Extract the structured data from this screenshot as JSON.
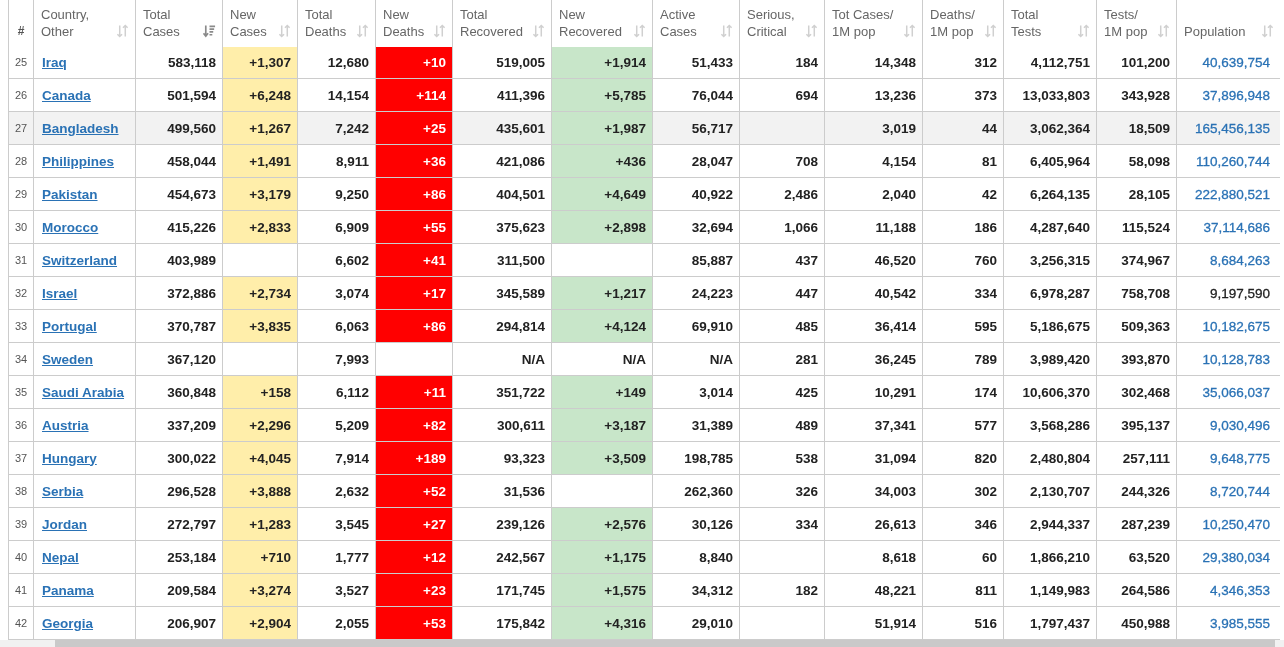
{
  "table": {
    "columns": [
      {
        "label": "#",
        "kind": "rank"
      },
      {
        "label": "Country,\nOther",
        "kind": "country",
        "sorted": false
      },
      {
        "label": "Total\nCases",
        "kind": "number",
        "sorted": true
      },
      {
        "label": "New\nCases",
        "kind": "new_cases",
        "sorted": false
      },
      {
        "label": "Total\nDeaths",
        "kind": "number",
        "sorted": false
      },
      {
        "label": "New\nDeaths",
        "kind": "new_deaths",
        "sorted": false
      },
      {
        "label": "Total\nRecovered",
        "kind": "number",
        "sorted": false
      },
      {
        "label": "New\nRecovered",
        "kind": "new_recovered",
        "sorted": false
      },
      {
        "label": "Active\nCases",
        "kind": "number",
        "sorted": false
      },
      {
        "label": "Serious,\nCritical",
        "kind": "number",
        "sorted": false
      },
      {
        "label": "Tot Cases/\n1M pop",
        "kind": "number",
        "sorted": false
      },
      {
        "label": "Deaths/\n1M pop",
        "kind": "number",
        "sorted": false
      },
      {
        "label": "Total\nTests",
        "kind": "number",
        "sorted": false
      },
      {
        "label": "Tests/\n1M pop",
        "kind": "number",
        "sorted": false
      },
      {
        "label": "Population",
        "kind": "population",
        "sorted": false
      }
    ],
    "rows": [
      {
        "selected": false,
        "cells": [
          "25",
          "Iraq",
          "583,118",
          {
            "value": "+1,307",
            "highlighted": true
          },
          "12,680",
          {
            "value": "+10",
            "highlighted": true
          },
          "519,005",
          {
            "value": "+1,914",
            "highlighted": true
          },
          "51,433",
          "184",
          "14,348",
          "312",
          "4,112,751",
          "101,200",
          {
            "value": "40,639,754",
            "link": true
          }
        ]
      },
      {
        "selected": false,
        "cells": [
          "26",
          "Canada",
          "501,594",
          {
            "value": "+6,248",
            "highlighted": true
          },
          "14,154",
          {
            "value": "+114",
            "highlighted": true
          },
          "411,396",
          {
            "value": "+5,785",
            "highlighted": true
          },
          "76,044",
          "694",
          "13,236",
          "373",
          "13,033,803",
          "343,928",
          {
            "value": "37,896,948",
            "link": true
          }
        ]
      },
      {
        "selected": true,
        "cells": [
          "27",
          "Bangladesh",
          "499,560",
          {
            "value": "+1,267",
            "highlighted": true
          },
          "7,242",
          {
            "value": "+25",
            "highlighted": true
          },
          "435,601",
          {
            "value": "+1,987",
            "highlighted": true
          },
          "56,717",
          null,
          "3,019",
          "44",
          "3,062,364",
          "18,509",
          {
            "value": "165,456,135",
            "link": true
          }
        ]
      },
      {
        "selected": false,
        "cells": [
          "28",
          "Philippines",
          "458,044",
          {
            "value": "+1,491",
            "highlighted": true
          },
          "8,911",
          {
            "value": "+36",
            "highlighted": true
          },
          "421,086",
          {
            "value": "+436",
            "highlighted": true
          },
          "28,047",
          "708",
          "4,154",
          "81",
          "6,405,964",
          "58,098",
          {
            "value": "110,260,744",
            "link": true
          }
        ]
      },
      {
        "selected": false,
        "cells": [
          "29",
          "Pakistan",
          "454,673",
          {
            "value": "+3,179",
            "highlighted": true
          },
          "9,250",
          {
            "value": "+86",
            "highlighted": true
          },
          "404,501",
          {
            "value": "+4,649",
            "highlighted": true
          },
          "40,922",
          "2,486",
          "2,040",
          "42",
          "6,264,135",
          "28,105",
          {
            "value": "222,880,521",
            "link": true
          }
        ]
      },
      {
        "selected": false,
        "cells": [
          "30",
          "Morocco",
          "415,226",
          {
            "value": "+2,833",
            "highlighted": true
          },
          "6,909",
          {
            "value": "+55",
            "highlighted": true
          },
          "375,623",
          {
            "value": "+2,898",
            "highlighted": true
          },
          "32,694",
          "1,066",
          "11,188",
          "186",
          "4,287,640",
          "115,524",
          {
            "value": "37,114,686",
            "link": true
          }
        ]
      },
      {
        "selected": false,
        "cells": [
          "31",
          "Switzerland",
          "403,989",
          {
            "highlighted": false
          },
          "6,602",
          {
            "value": "+41",
            "highlighted": true
          },
          "311,500",
          {
            "highlighted": false
          },
          "85,887",
          "437",
          "46,520",
          "760",
          "3,256,315",
          "374,967",
          {
            "value": "8,684,263",
            "link": true
          }
        ]
      },
      {
        "selected": false,
        "cells": [
          "32",
          "Israel",
          "372,886",
          {
            "value": "+2,734",
            "highlighted": true
          },
          "3,074",
          {
            "value": "+17",
            "highlighted": true
          },
          "345,589",
          {
            "value": "+1,217",
            "highlighted": true
          },
          "24,223",
          "447",
          "40,542",
          "334",
          "6,978,287",
          "758,708",
          {
            "value": "9,197,590",
            "link": false
          }
        ]
      },
      {
        "selected": false,
        "cells": [
          "33",
          "Portugal",
          "370,787",
          {
            "value": "+3,835",
            "highlighted": true
          },
          "6,063",
          {
            "value": "+86",
            "highlighted": true
          },
          "294,814",
          {
            "value": "+4,124",
            "highlighted": true
          },
          "69,910",
          "485",
          "36,414",
          "595",
          "5,186,675",
          "509,363",
          {
            "value": "10,182,675",
            "link": true
          }
        ]
      },
      {
        "selected": false,
        "cells": [
          "34",
          "Sweden",
          "367,120",
          {
            "highlighted": false
          },
          "7,993",
          {
            "highlighted": false
          },
          "N/A",
          {
            "value": "N/A",
            "highlighted": false
          },
          "N/A",
          "281",
          "36,245",
          "789",
          "3,989,420",
          "393,870",
          {
            "value": "10,128,783",
            "link": true
          }
        ]
      },
      {
        "selected": false,
        "cells": [
          "35",
          "Saudi Arabia",
          "360,848",
          {
            "value": "+158",
            "highlighted": true
          },
          "6,112",
          {
            "value": "+11",
            "highlighted": true
          },
          "351,722",
          {
            "value": "+149",
            "highlighted": true
          },
          "3,014",
          "425",
          "10,291",
          "174",
          "10,606,370",
          "302,468",
          {
            "value": "35,066,037",
            "link": true
          }
        ]
      },
      {
        "selected": false,
        "cells": [
          "36",
          "Austria",
          "337,209",
          {
            "value": "+2,296",
            "highlighted": true
          },
          "5,209",
          {
            "value": "+82",
            "highlighted": true
          },
          "300,611",
          {
            "value": "+3,187",
            "highlighted": true
          },
          "31,389",
          "489",
          "37,341",
          "577",
          "3,568,286",
          "395,137",
          {
            "value": "9,030,496",
            "link": true
          }
        ]
      },
      {
        "selected": false,
        "cells": [
          "37",
          "Hungary",
          "300,022",
          {
            "value": "+4,045",
            "highlighted": true
          },
          "7,914",
          {
            "value": "+189",
            "highlighted": true
          },
          "93,323",
          {
            "value": "+3,509",
            "highlighted": true
          },
          "198,785",
          "538",
          "31,094",
          "820",
          "2,480,804",
          "257,111",
          {
            "value": "9,648,775",
            "link": true
          }
        ]
      },
      {
        "selected": false,
        "cells": [
          "38",
          "Serbia",
          "296,528",
          {
            "value": "+3,888",
            "highlighted": true
          },
          "2,632",
          {
            "value": "+52",
            "highlighted": true
          },
          "31,536",
          {
            "highlighted": false
          },
          "262,360",
          "326",
          "34,003",
          "302",
          "2,130,707",
          "244,326",
          {
            "value": "8,720,744",
            "link": true
          }
        ]
      },
      {
        "selected": false,
        "cells": [
          "39",
          "Jordan",
          "272,797",
          {
            "value": "+1,283",
            "highlighted": true
          },
          "3,545",
          {
            "value": "+27",
            "highlighted": true
          },
          "239,126",
          {
            "value": "+2,576",
            "highlighted": true
          },
          "30,126",
          "334",
          "26,613",
          "346",
          "2,944,337",
          "287,239",
          {
            "value": "10,250,470",
            "link": true
          }
        ]
      },
      {
        "selected": false,
        "cells": [
          "40",
          "Nepal",
          "253,184",
          {
            "value": "+710",
            "highlighted": true
          },
          "1,777",
          {
            "value": "+12",
            "highlighted": true
          },
          "242,567",
          {
            "value": "+1,175",
            "highlighted": true
          },
          "8,840",
          null,
          "8,618",
          "60",
          "1,866,210",
          "63,520",
          {
            "value": "29,380,034",
            "link": true
          }
        ]
      },
      {
        "selected": false,
        "cells": [
          "41",
          "Panama",
          "209,584",
          {
            "value": "+3,274",
            "highlighted": true
          },
          "3,527",
          {
            "value": "+23",
            "highlighted": true
          },
          "171,745",
          {
            "value": "+1,575",
            "highlighted": true
          },
          "34,312",
          "182",
          "48,221",
          "811",
          "1,149,983",
          "264,586",
          {
            "value": "4,346,353",
            "link": true
          }
        ]
      },
      {
        "selected": false,
        "cells": [
          "42",
          "Georgia",
          "206,907",
          {
            "value": "+2,904",
            "highlighted": true
          },
          "2,055",
          {
            "value": "+53",
            "highlighted": true
          },
          "175,842",
          {
            "value": "+4,316",
            "highlighted": true
          },
          "29,010",
          null,
          "51,914",
          "516",
          "1,797,437",
          "450,988",
          {
            "value": "3,985,555",
            "link": true
          }
        ]
      }
    ]
  }
}
